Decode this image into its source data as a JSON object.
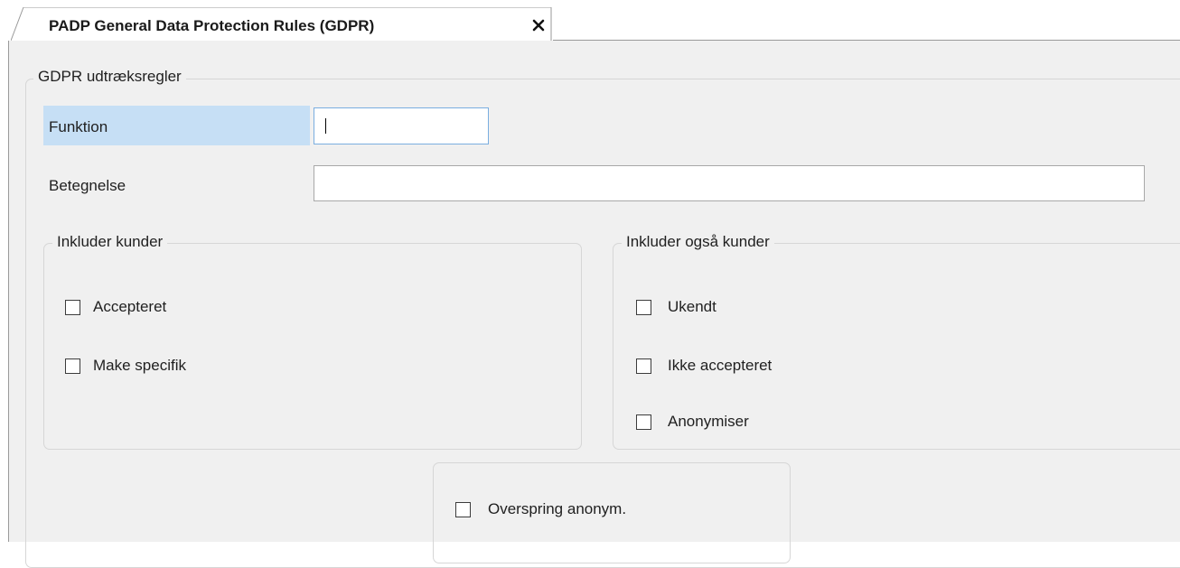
{
  "tab": {
    "title": "PADP General Data Protection Rules (GDPR)",
    "close_icon": "close-icon"
  },
  "main_group": {
    "title": "GDPR udtræksregler"
  },
  "fields": {
    "funktion": {
      "label": "Funktion",
      "value": ""
    },
    "betegnelse": {
      "label": "Betegnelse",
      "value": ""
    }
  },
  "include_customers": {
    "title": "Inkluder kunder",
    "options": [
      {
        "label": "Accepteret",
        "checked": false
      },
      {
        "label": "Make specifik",
        "checked": false
      }
    ]
  },
  "include_also_customers": {
    "title": "Inkluder også kunder",
    "options": [
      {
        "label": "Ukendt",
        "checked": false
      },
      {
        "label": "Ikke accepteret",
        "checked": false
      },
      {
        "label": "Anonymiser",
        "checked": false
      }
    ]
  },
  "skip_group": {
    "options": [
      {
        "label": "Overspring anonym.",
        "checked": false
      }
    ]
  },
  "colors": {
    "highlight": "#c6dff5",
    "panel_background": "#f0f0f0",
    "border": "#d6d6d6"
  }
}
